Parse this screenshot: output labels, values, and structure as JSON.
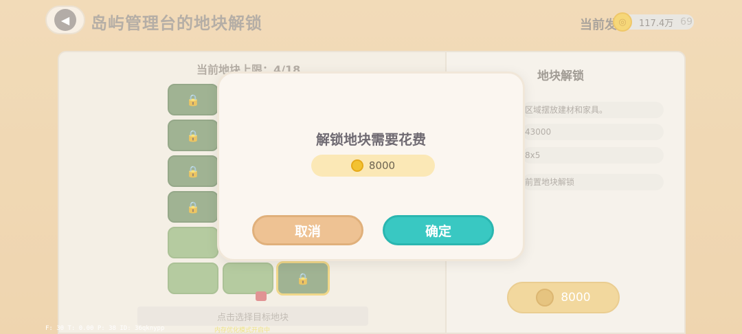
{
  "header": {
    "title": "岛屿管理台的地块解锁",
    "currency_label": "当前发",
    "currency_amount": "117.4万",
    "currency_extra": "69"
  },
  "board": {
    "plot_limit": "当前地块上限：4/18",
    "hint": "点击选择目标地块"
  },
  "info_panel": {
    "title": "地块解锁",
    "rows": [
      "区域摆放建材和家具。",
      "43000",
      "8x5",
      "前置地块解锁"
    ],
    "unlock_cost": "8000"
  },
  "debug": {
    "stats": "F: 30   T: 0.00   P: 38   ID: 36qknypp",
    "notice": "内存优化模式开启中"
  },
  "dialog": {
    "title": "解锁地块需要花费",
    "cost": "8000",
    "cancel_label": "取消",
    "confirm_label": "确定"
  },
  "icons": {
    "back": "chevron-left-icon",
    "coin": "coin-icon",
    "lock": "lock-icon"
  },
  "colors": {
    "confirm": "#39c8c2",
    "cancel": "#eec293",
    "cost_bg": "#fbe8b6"
  }
}
